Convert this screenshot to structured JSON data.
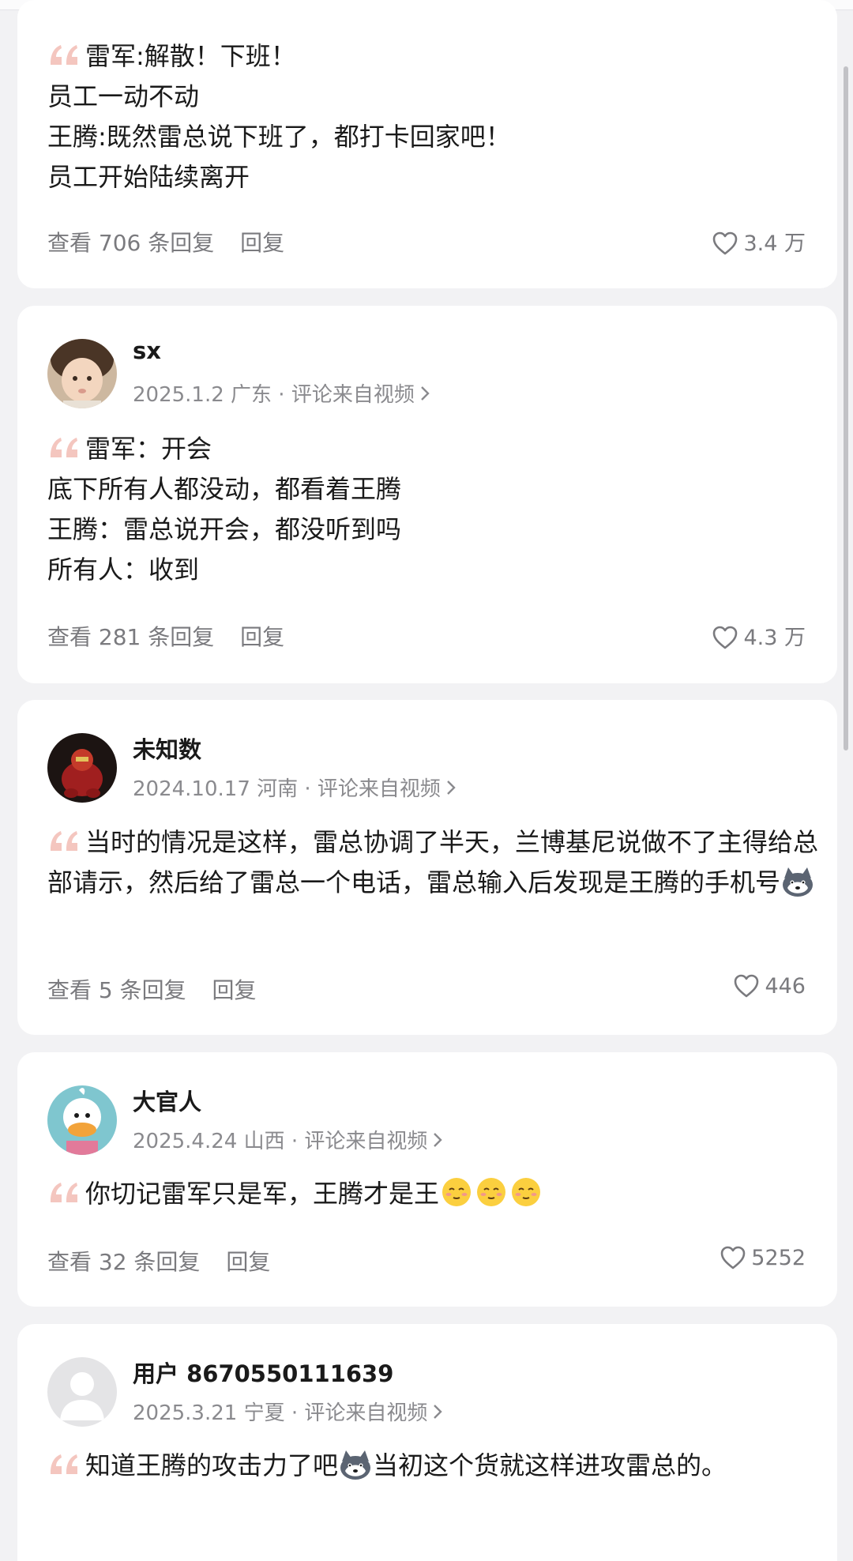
{
  "comments": [
    {
      "lines": [
        "雷军:解散！下班！",
        "员工一动不动",
        "王腾:既然雷总说下班了，都打卡回家吧！",
        "员工开始陆续离开"
      ],
      "view_replies": "查看 706 条回复",
      "reply": "回复",
      "likes": "3.4 万"
    },
    {
      "username": "sx",
      "meta": "2025.1.2 广东 · 评论来自视频",
      "lines": [
        "雷军：开会",
        "底下所有人都没动，都看着王腾",
        "王腾：雷总说开会，都没听到吗",
        "所有人：收到"
      ],
      "view_replies": "查看 281 条回复",
      "reply": "回复",
      "likes": "4.3 万"
    },
    {
      "username": "未知数",
      "meta": "2024.10.17 河南 · 评论来自视频",
      "text": "当时的情况是这样，雷总协调了半天，兰博基尼说做不了主得给总部请示，然后给了雷总一个电话，雷总输入后发现是王腾的手机号",
      "view_replies": "查看 5 条回复",
      "reply": "回复",
      "likes": "446"
    },
    {
      "username": "大官人",
      "meta": "2025.4.24 山西 · 评论来自视频",
      "text": "你切记雷军只是军，王腾才是王",
      "view_replies": "查看 32 条回复",
      "reply": "回复",
      "likes": "5252"
    },
    {
      "username": "用户 8670550111639",
      "meta": "2025.3.21 宁夏 · 评论来自视频",
      "text_a": "知道王腾的攻击力了吧",
      "text_b": "当初这个货就这样进攻雷总的。"
    }
  ],
  "icons": {
    "quote": "quote-mark-icon",
    "like": "heart-outline-icon",
    "chevron": "chevron-right-icon",
    "husky": "husky-dog-emoji",
    "smile": "smiling-face-emoji"
  },
  "colors": {
    "background": "#f2f2f4",
    "card": "#ffffff",
    "text": "#1a1a1a",
    "secondary_text": "#7a7a7e",
    "quote_mark": "#f4c6bf"
  }
}
